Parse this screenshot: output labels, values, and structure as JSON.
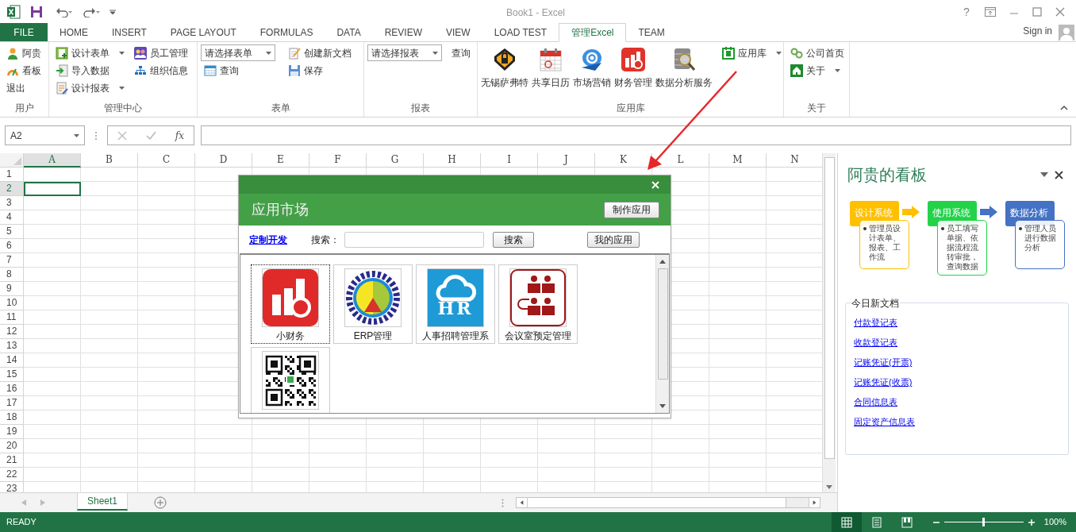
{
  "window": {
    "title": "Book1 - Excel",
    "help_button": "?"
  },
  "tabs": [
    {
      "label": "FILE",
      "kind": "file",
      "selected": false
    },
    {
      "label": "HOME",
      "kind": "tab",
      "selected": false
    },
    {
      "label": "INSERT",
      "kind": "tab",
      "selected": false
    },
    {
      "label": "PAGE LAYOUT",
      "kind": "tab",
      "selected": false
    },
    {
      "label": "FORMULAS",
      "kind": "tab",
      "selected": false
    },
    {
      "label": "DATA",
      "kind": "tab",
      "selected": false
    },
    {
      "label": "REVIEW",
      "kind": "tab",
      "selected": false
    },
    {
      "label": "VIEW",
      "kind": "tab",
      "selected": false
    },
    {
      "label": "LOAD TEST",
      "kind": "tab",
      "selected": false
    },
    {
      "label": "管理Excel",
      "kind": "tab",
      "selected": true
    },
    {
      "label": "TEAM",
      "kind": "tab",
      "selected": false
    }
  ],
  "account": {
    "label": "Sign in"
  },
  "ribbon": {
    "user_group": {
      "label": "用户",
      "buttons": [
        "阿贵",
        "看板",
        "退出"
      ]
    },
    "admin_group": {
      "label": "管理中心",
      "buttons": [
        {
          "label": "设计表单",
          "menu": true
        },
        {
          "label": "导入数据",
          "menu": false
        },
        {
          "label": "设计报表",
          "menu": true
        },
        {
          "label": "员工管理",
          "menu": false
        },
        {
          "label": "组织信息",
          "menu": false
        }
      ]
    },
    "form_group": {
      "label": "表单",
      "dropdown": "请选择表单",
      "buttons": [
        "查询",
        "创建新文档",
        "保存"
      ]
    },
    "report_group": {
      "label": "报表",
      "dropdown": "请选择报表",
      "buttons": [
        "查询"
      ]
    },
    "apps_group": {
      "label": "应用库",
      "large_buttons": [
        "无锡萨弗特",
        "共享日历",
        "市场营销",
        "财务管理",
        "数据分析服务"
      ],
      "menu_button": {
        "label": "应用库",
        "menu": true
      }
    },
    "about_group": {
      "label": "关于",
      "buttons": [
        {
          "label": "公司首页",
          "menu": false
        },
        {
          "label": "关于",
          "menu": true
        }
      ]
    }
  },
  "formula_bar": {
    "name_box": "A2",
    "function_label": "fx"
  },
  "sheet": {
    "columns": [
      {
        "label": "A",
        "selected": true
      },
      {
        "label": "B",
        "selected": false
      },
      {
        "label": "C",
        "selected": false
      },
      {
        "label": "D",
        "selected": false
      },
      {
        "label": "E",
        "selected": false
      },
      {
        "label": "F",
        "selected": false
      },
      {
        "label": "G",
        "selected": false
      },
      {
        "label": "H",
        "selected": false
      },
      {
        "label": "I",
        "selected": false
      },
      {
        "label": "J",
        "selected": false
      },
      {
        "label": "K",
        "selected": false
      },
      {
        "label": "L",
        "selected": false
      },
      {
        "label": "M",
        "selected": false
      },
      {
        "label": "N",
        "selected": false
      }
    ],
    "rows": [
      {
        "label": "1",
        "selected": false
      },
      {
        "label": "2",
        "selected": true
      },
      {
        "label": "3",
        "selected": false
      },
      {
        "label": "4",
        "selected": false
      },
      {
        "label": "5",
        "selected": false
      },
      {
        "label": "6",
        "selected": false
      },
      {
        "label": "7",
        "selected": false
      },
      {
        "label": "8",
        "selected": false
      },
      {
        "label": "9",
        "selected": false
      },
      {
        "label": "10",
        "selected": false
      },
      {
        "label": "11",
        "selected": false
      },
      {
        "label": "12",
        "selected": false
      },
      {
        "label": "13",
        "selected": false
      },
      {
        "label": "14",
        "selected": false
      },
      {
        "label": "15",
        "selected": false
      },
      {
        "label": "16",
        "selected": false
      },
      {
        "label": "17",
        "selected": false
      },
      {
        "label": "18",
        "selected": false
      },
      {
        "label": "19",
        "selected": false
      },
      {
        "label": "20",
        "selected": false
      },
      {
        "label": "21",
        "selected": false
      },
      {
        "label": "22",
        "selected": false
      },
      {
        "label": "23",
        "selected": false
      }
    ]
  },
  "sheet_tabs": [
    {
      "label": "Sheet1",
      "selected": true
    }
  ],
  "dialog": {
    "title": "应用市场",
    "make_button": "制作应用",
    "custom_link": "定制开发",
    "search": {
      "label": "搜索：",
      "button": "搜索"
    },
    "my_apps_button": "我的应用",
    "apps": [
      {
        "label": "小财务",
        "selected": true
      },
      {
        "label": "ERP管理",
        "selected": false
      },
      {
        "label": "人事招聘管理系",
        "icon_text": "HR",
        "selected": false
      },
      {
        "label": "会议室预定管理",
        "selected": false
      },
      {
        "selected": false
      }
    ]
  },
  "task_pane": {
    "title": "阿贵的看板",
    "steps": [
      {
        "title": "设计系统",
        "color": "#ffc000",
        "text": "管理员设计表单、报表、工作流"
      },
      {
        "title": "使用系统",
        "color": "#22d34a",
        "text": "员工填写单据、依据流程流转审批，查询数据"
      },
      {
        "title": "数据分析",
        "color": "#4472c4",
        "text": "管理人员进行数据分析"
      }
    ],
    "documents": {
      "title": "今日新文档",
      "links": [
        "付款登记表",
        "收款登记表",
        "记账凭证(开票)",
        "记账凭证(收票)",
        "合同信息表",
        "固定资产信息表"
      ]
    }
  },
  "status_bar": {
    "status": "READY",
    "views": [
      {
        "selected": true
      },
      {
        "selected": false
      },
      {
        "selected": false
      }
    ],
    "zoom": {
      "level": 0.5,
      "reading": "100%"
    }
  }
}
